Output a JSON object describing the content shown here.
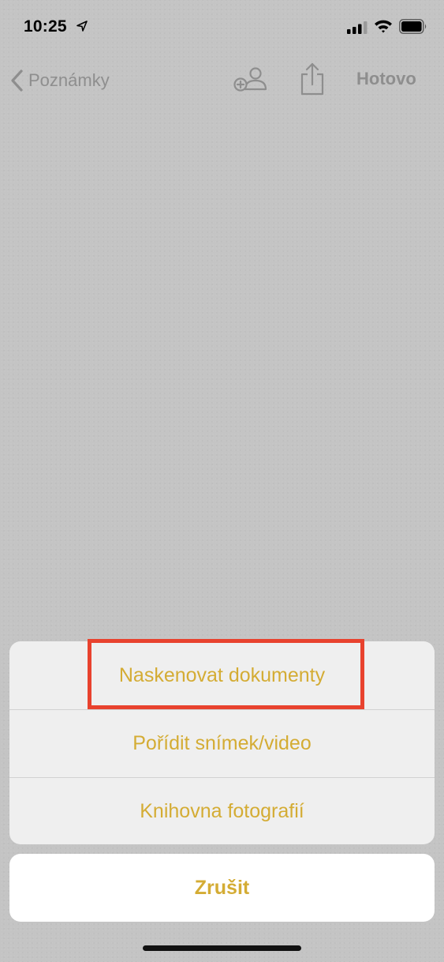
{
  "status_bar": {
    "time": "10:25"
  },
  "nav": {
    "back_label": "Poznámky",
    "done_label": "Hotovo"
  },
  "action_sheet": {
    "items": [
      {
        "label": "Naskenovat dokumenty",
        "highlighted": true
      },
      {
        "label": "Pořídit snímek/video"
      },
      {
        "label": "Knihovna fotografií"
      }
    ],
    "cancel_label": "Zrušit"
  },
  "colors": {
    "accent": "#d4ac34",
    "highlight": "#e8422e",
    "backdrop": "#c4c4c4",
    "nav_text": "#8e8e8e"
  },
  "icons": [
    "location-arrow-icon",
    "cellular-signal-icon",
    "wifi-icon",
    "battery-icon",
    "chevron-left-icon",
    "add-people-icon",
    "share-icon"
  ]
}
